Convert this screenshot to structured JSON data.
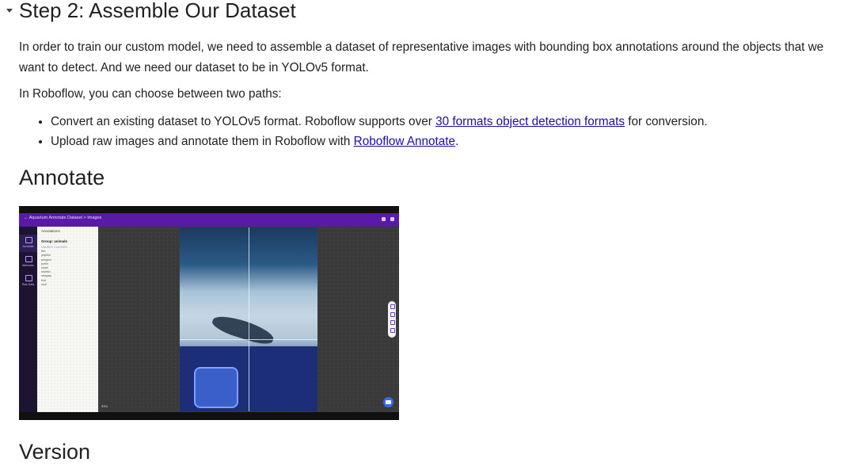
{
  "section": {
    "title": "Step 2: Assemble Our Dataset",
    "caret_icon": "triangle-down-icon"
  },
  "intro": {
    "p1": "In order to train our custom model, we need to assemble a dataset of representative images with bounding box annotations around the objects that we want to detect. And we need our dataset to be in YOLOv5 format.",
    "p2": "In Roboflow, you can choose between two paths:"
  },
  "paths": [
    {
      "before": "Convert an existing dataset to YOLOv5 format. Roboflow supports over ",
      "link": "30 formats object detection formats",
      "after": " for conversion."
    },
    {
      "before": "Upload raw images and annotate them in Roboflow with ",
      "link": "Roboflow Annotate",
      "after": "."
    }
  ],
  "annotate_heading": "Annotate",
  "next_heading": "Version",
  "screenshot": {
    "breadcrumb": "←  Aquarium Annotate Dataset  >  Images",
    "rail": [
      {
        "label": "Annotate",
        "icon": "annotate-icon"
      },
      {
        "label": "Attributes",
        "icon": "tag-icon"
      },
      {
        "label": "Raw Data",
        "icon": "code-icon"
      }
    ],
    "panel": {
      "title": "Annotations",
      "group": "Group: animals",
      "classes": [
        "UNUSED CLASSES",
        "fish",
        "jellyfish",
        "penguin",
        "puffin",
        "shark",
        "starfish",
        "stingray",
        "bird",
        "seal"
      ]
    },
    "zoom": "  53%  ",
    "colors": {
      "topbar": "#5a1aa8",
      "rail": "#1c1430",
      "canvas": "#3a3a3a",
      "chat": "#2f6ef0"
    }
  }
}
